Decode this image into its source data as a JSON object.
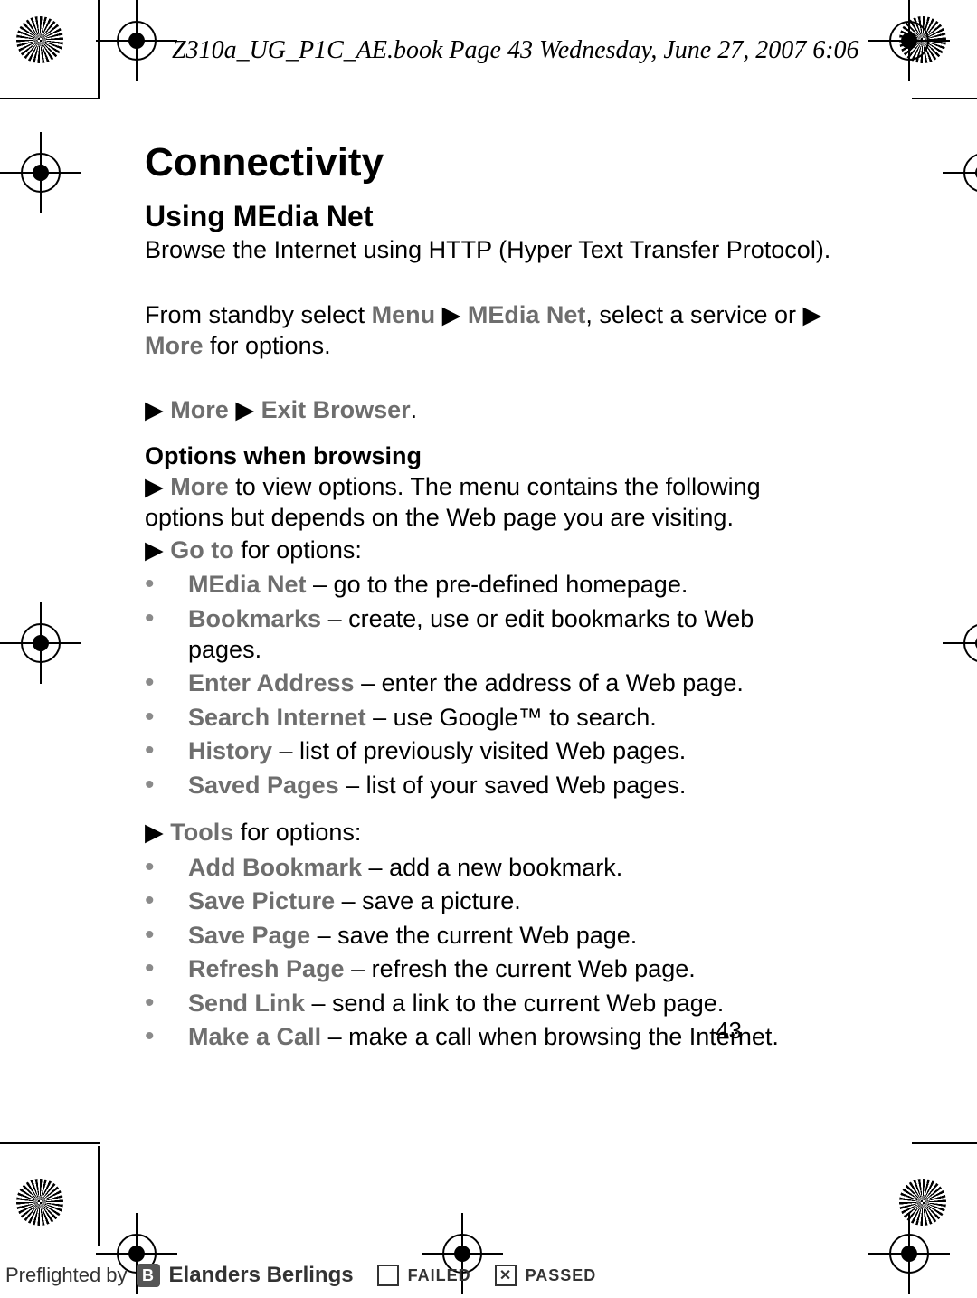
{
  "doc_header": "Z310a_UG_P1C_AE.book  Page 43  Wednesday, June 27, 2007  6:06",
  "page_number": "43",
  "title": "Connectivity",
  "section_title": "Using MEdia Net",
  "intro": {
    "prefix": "Browse the Internet using HTTP (Hyper Text Transfer Protocol)."
  },
  "nav": {
    "prefix": "From standby select ",
    "menu": "Menu",
    "arrow": "▶",
    "media_net": "MEdia Net",
    "mid": ", select a service or ",
    "tri": "▶",
    "more": "More",
    "suffix": " for options."
  },
  "exit_line": {
    "tri": "▶",
    "more": "More",
    "arrow": "▶",
    "exit": "Exit Browser",
    "period": "."
  },
  "options_heading": "Options when browsing",
  "options_intro": {
    "tri": "▶",
    "more": "More",
    "text": " to view options. The menu contains the following options but depends on the Web page you are visiting."
  },
  "goto_line": {
    "tri": "▶",
    "label": "Go to",
    "suffix": " for options:"
  },
  "goto_options": [
    {
      "label": "MEdia Net",
      "desc": " – go to the pre-defined homepage."
    },
    {
      "label": "Bookmarks",
      "desc": " – create, use or edit bookmarks to Web pages."
    },
    {
      "label": "Enter Address",
      "desc": " – enter the address of a Web page."
    },
    {
      "label": "Search Internet",
      "desc": " – use Google™ to search."
    },
    {
      "label": "History",
      "desc": " – list of previously visited Web pages."
    },
    {
      "label": "Saved Pages",
      "desc": " – list of your saved Web pages."
    }
  ],
  "tools_line": {
    "tri": "▶",
    "label": "Tools",
    "suffix": " for options:"
  },
  "tools_options": [
    {
      "label": "Add Bookmark",
      "desc": " – add a new bookmark."
    },
    {
      "label": "Save Picture",
      "desc": " – save a picture."
    },
    {
      "label": "Save Page",
      "desc": " – save the current Web page."
    },
    {
      "label": "Refresh Page",
      "desc": " – refresh the current Web page."
    },
    {
      "label": "Send Link",
      "desc": " – send a link to the current Web page."
    },
    {
      "label": "Make a Call",
      "desc": " – make a call when browsing the Internet."
    }
  ],
  "preflight": {
    "by": "Preflighted by",
    "brand": "Elanders Berlings",
    "failed": "FAILED",
    "passed": "PASSED"
  }
}
